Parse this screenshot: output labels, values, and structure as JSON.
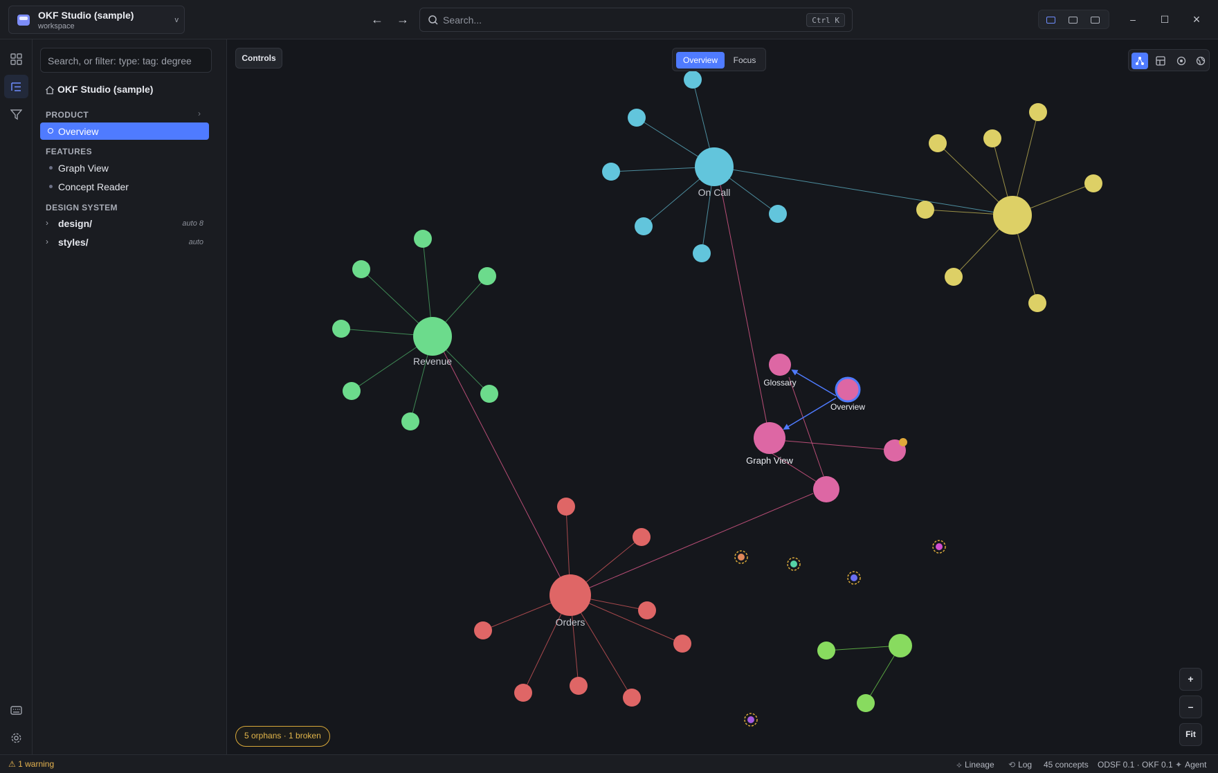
{
  "workspace": {
    "title": "OKF Studio (sample)",
    "subtitle": "workspace",
    "chevron": "v"
  },
  "nav": {
    "back_icon": "←",
    "forward_icon": "→"
  },
  "search": {
    "placeholder": "Search...",
    "shortcut": "Ctrl K"
  },
  "window_controls": {
    "minimize": "–",
    "maximize": "☐",
    "close": "×"
  },
  "sidebar": {
    "filter_placeholder": "Search, or filter: type: tag: degree",
    "root_label": "OKF Studio (sample)",
    "sections": [
      {
        "title": "PRODUCT",
        "items": [
          {
            "label": "Overview",
            "active": true
          }
        ]
      },
      {
        "title": "FEATURES",
        "items": [
          {
            "label": "Graph View"
          },
          {
            "label": "Concept Reader"
          }
        ]
      },
      {
        "title": "DESIGN SYSTEM",
        "folders": [
          {
            "label": "design/",
            "meta": "auto 8"
          },
          {
            "label": "styles/",
            "meta": "auto"
          }
        ]
      }
    ],
    "section_chevron": "›",
    "folder_chevron": "›"
  },
  "canvas": {
    "controls_label": "Controls",
    "view_tabs": [
      {
        "label": "Overview",
        "active": true
      },
      {
        "label": "Focus",
        "active": false
      }
    ],
    "zoom_in": "+",
    "zoom_out": "–",
    "fit": "Fit",
    "orphans_badge": "5 orphans · 1 broken"
  },
  "graph": {
    "colors": {
      "cyan": "#62c5dc",
      "yellow": "#ddd066",
      "green": "#6cdb8c",
      "pink": "#dd67a4",
      "red": "#df6666",
      "lime": "#88db5f",
      "blue": "#4f7bff"
    },
    "labels": {
      "on_call": "On Call",
      "revenue": "Revenue",
      "orders": "Orders",
      "glossary": "Glossary",
      "overview": "Overview",
      "graph_view": "Graph View"
    }
  },
  "status": {
    "warning": "1 warning",
    "lineage": "Lineage",
    "log": "Log",
    "concepts": "45 concepts",
    "versions": "ODSF 0.1 · OKF 0.1",
    "agent": "Agent"
  }
}
